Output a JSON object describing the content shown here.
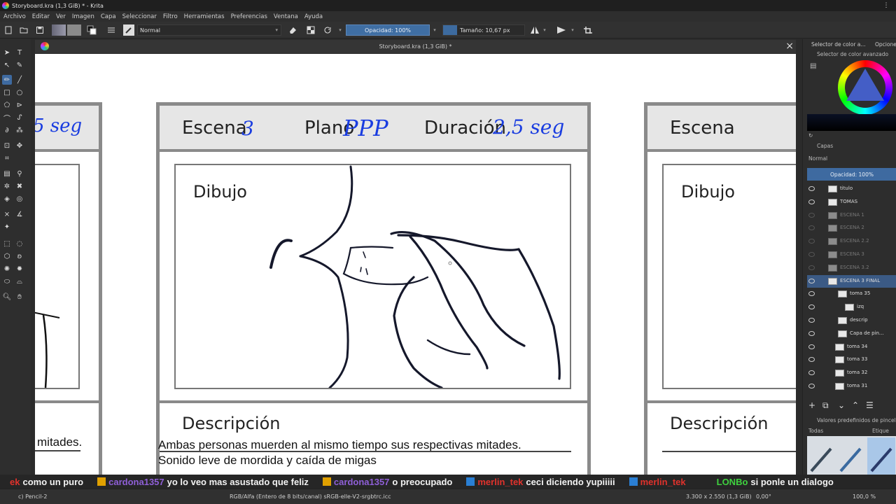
{
  "window": {
    "title": "Storyboard.kra (1,3 GiB) * - Krita"
  },
  "menu": [
    "Archivo",
    "Editar",
    "Ver",
    "Imagen",
    "Capa",
    "Seleccionar",
    "Filtro",
    "Herramientas",
    "Preferencias",
    "Ventana",
    "Ayuda"
  ],
  "toolbar": {
    "blend_mode": "Normal",
    "opacity": "Opacidad: 100%",
    "size": "Tamaño: 10,67 px"
  },
  "document": {
    "tab_title": "Storyboard.kra (1,3 GiB) *"
  },
  "storyboard": {
    "left_panel": {
      "duration_hand": "5 seg",
      "desc_text": "mitades."
    },
    "center_panel": {
      "escena_label": "Escena",
      "escena_hand": "3",
      "plano_label": "Plano",
      "plano_hand": "PPP",
      "duracion_label": "Duración",
      "duracion_hand": "2,5 seg",
      "dibujo_label": "Dibujo",
      "descripcion_label": "Descripción",
      "desc_line1": "Ambas personas muerden al mismo tiempo sus respectivas mitades.",
      "desc_line2": "Sonido leve de mordida y caída de migas"
    },
    "right_panel": {
      "escena_label": "Escena",
      "dibujo_label": "Dibujo",
      "descripcion_label": "Descripción"
    }
  },
  "dock": {
    "tab_color": "Selector de color a...",
    "tab_options": "Opcione",
    "color_selector_title": "Selector de color avanzado",
    "layers_title": "Capas",
    "layers_blend": "Normal",
    "layers_opacity": "Opacidad:  100%",
    "layers": [
      {
        "name": "titulo",
        "kind": "vector",
        "visible": true
      },
      {
        "name": "TOMAS",
        "kind": "group",
        "visible": true
      },
      {
        "name": "ESCENA 1",
        "kind": "group",
        "visible": false
      },
      {
        "name": "ESCENA 2",
        "kind": "group",
        "visible": false
      },
      {
        "name": "ESCENA 2.2",
        "kind": "group",
        "visible": false
      },
      {
        "name": "ESCENA 3",
        "kind": "group",
        "visible": false
      },
      {
        "name": "ESCENA 3.2",
        "kind": "group",
        "visible": false
      },
      {
        "name": "ESCENA 3 FINAL",
        "kind": "group",
        "visible": true,
        "selected": true
      },
      {
        "name": "toma 35",
        "kind": "group",
        "visible": true
      },
      {
        "name": "izq",
        "kind": "group",
        "visible": true
      },
      {
        "name": "descrip",
        "kind": "vector",
        "visible": true
      },
      {
        "name": "Capa de pin...",
        "kind": "vector",
        "visible": true
      },
      {
        "name": "toma 34",
        "kind": "group",
        "visible": true
      },
      {
        "name": "toma 33",
        "kind": "group",
        "visible": true
      },
      {
        "name": "toma 32",
        "kind": "group",
        "visible": true
      },
      {
        "name": "toma 31",
        "kind": "group",
        "visible": true
      }
    ],
    "brush_presets_title": "Valores predefinidos de pincel",
    "brush_filter": "Todas",
    "brush_tag": "Etique"
  },
  "chat": [
    {
      "user": "ek",
      "msg": "como un puro",
      "color": "#e0322c"
    },
    {
      "user": "cardona1357",
      "msg": "yo lo veo mas asustado que feliz",
      "color": "#8f5fd8"
    },
    {
      "user": "cardona1357",
      "msg": "o preocupado",
      "color": "#8f5fd8"
    },
    {
      "user": "merlin_tek",
      "msg": "ceci diciendo yupiiiii",
      "color": "#e0322c"
    },
    {
      "user": "merlin_tek",
      "msg": "",
      "color": "#e0322c"
    },
    {
      "user": "LONBo",
      "msg": "si ponle un dialogo",
      "color": "#3fd13f"
    }
  ],
  "status": {
    "brush": "c) Pencil-2",
    "color_space": "RGB/Alfa (Entero de 8 bits/canal)  sRGB-elle-V2-srgbtrc.icc",
    "dimensions": "3.300 x 2.550 (1,3 GiB)",
    "rotation": "0,00°",
    "zoom": "100,0 %"
  }
}
